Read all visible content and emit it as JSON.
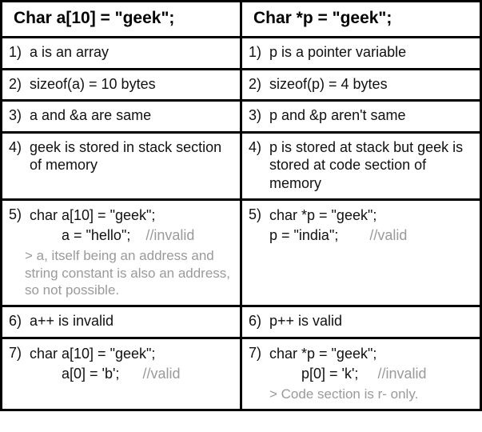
{
  "header": {
    "left": "Char a[10] = \"geek\";",
    "right": "Char *p = \"geek\";"
  },
  "rows": [
    {
      "n": "1)",
      "left": {
        "text": "a is an array"
      },
      "right": {
        "text": "p is a pointer variable"
      }
    },
    {
      "n": "2)",
      "left": {
        "text": "sizeof(a) = 10 bytes"
      },
      "right": {
        "text": "sizeof(p) = 4 bytes"
      }
    },
    {
      "n": "3)",
      "left": {
        "text": "a and &a are same"
      },
      "right": {
        "text": "p and &p aren't same"
      }
    },
    {
      "n": "4)",
      "left": {
        "text": "geek is stored in stack section of memory"
      },
      "right": {
        "text": "p is stored at stack but geek is stored at code section of memory"
      }
    },
    {
      "n": "5)",
      "left": {
        "code1": "char a[10] = \"geek\";",
        "code2": "a = \"hello\";",
        "cmt": "//invalid",
        "note": "> a, itself being an address and string constant is also an address, so not possible."
      },
      "right": {
        "code1": "char *p = \"geek\";",
        "code2": "p = \"india\";",
        "cmt": "//valid"
      }
    },
    {
      "n": "6)",
      "left": {
        "text": "a++ is invalid"
      },
      "right": {
        "text": "p++ is valid"
      }
    },
    {
      "n": "7)",
      "left": {
        "code1": "char a[10] = \"geek\";",
        "code2": "a[0] = 'b';",
        "cmt": "//valid"
      },
      "right": {
        "code1": "char *p = \"geek\";",
        "code2": "p[0] = 'k';",
        "cmt": "//invalid",
        "note": "> Code section is r- only."
      }
    }
  ]
}
